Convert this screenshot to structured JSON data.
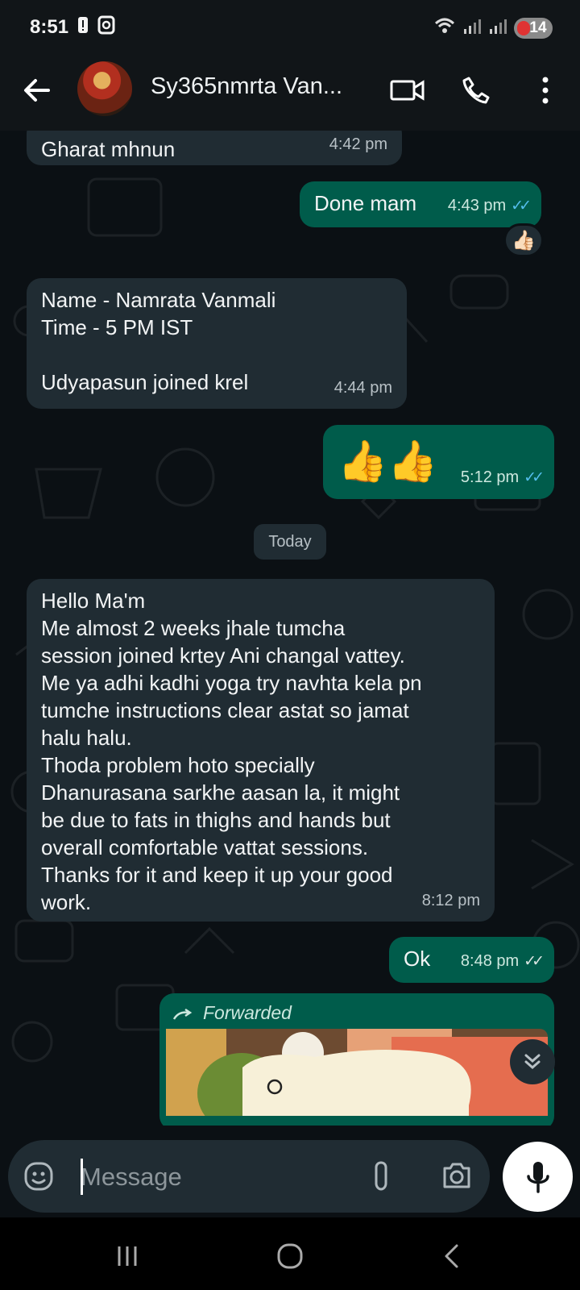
{
  "status_bar": {
    "time": "8:51",
    "battery_level": "14",
    "left_icons": [
      "alert-icon",
      "sync-icon"
    ],
    "right_icons": [
      "wifi-icon",
      "signal-icon",
      "signal-icon"
    ]
  },
  "header": {
    "contact_name": "Sy365nmrta Van...",
    "icons": [
      "back-arrow-icon",
      "video-call-icon",
      "phone-icon",
      "more-vertical-icon"
    ]
  },
  "messages": [
    {
      "direction": "incoming",
      "text": "Gharat mhnun",
      "time": "4:42 pm"
    },
    {
      "direction": "outgoing",
      "text": "Done mam",
      "time": "4:43 pm",
      "status": "read",
      "reaction": "👍🏻"
    },
    {
      "direction": "incoming",
      "text": "Name - Namrata Vanmali\nTime - 5 PM IST\n\nUdyapasun joined krel",
      "time": "4:44 pm"
    },
    {
      "direction": "outgoing",
      "text": "👍👍",
      "time": "5:12 pm",
      "status": "read"
    },
    {
      "direction": "incoming",
      "text": "Hello Ma'm\nMe almost 2 weeks jhale tumcha\nsession joined krtey Ani changal vattey.\nMe ya adhi kadhi yoga try navhta kela pn\ntumche instructions clear astat so jamat\nhalu halu.\nThoda problem hoto specially\nDhanurasana sarkhe aasan la, it might\nbe due to fats in thighs and hands but\noverall comfortable vattat sessions.\nThanks for it and keep it up your good\nwork.",
      "time": "8:12 pm"
    },
    {
      "direction": "outgoing",
      "text": "Ok",
      "time": "8:48 pm",
      "status": "delivered"
    },
    {
      "direction": "outgoing",
      "forwarded_label": "Forwarded",
      "media": "image"
    }
  ],
  "date_separator": "Today",
  "composer": {
    "placeholder": "Message",
    "icons": [
      "emoji-icon",
      "attach-icon",
      "camera-icon",
      "mic-icon"
    ]
  },
  "navigation": [
    "recents-icon",
    "home-icon",
    "back-icon"
  ],
  "colors": {
    "incoming_bubble": "#202c33",
    "outgoing_bubble": "#005c4b",
    "read_ticks": "#53bdeb"
  }
}
